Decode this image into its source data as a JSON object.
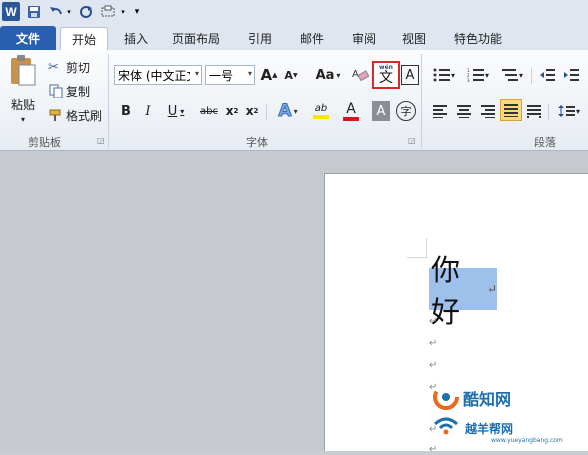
{
  "qat": {
    "app_logo": "W",
    "icons": [
      "save-icon",
      "undo-icon",
      "redo-icon",
      "print-preview-icon",
      "customize-qat-icon"
    ]
  },
  "tabs": [
    "文件",
    "开始",
    "插入",
    "页面布局",
    "引用",
    "邮件",
    "审阅",
    "视图",
    "特色功能"
  ],
  "clipboard": {
    "paste": "粘贴",
    "cut": "剪切",
    "copy": "复制",
    "format_painter": "格式刷",
    "group_label": "剪贴板"
  },
  "font": {
    "font_name": "宋体 (中文正文",
    "font_size": "一号",
    "grow_label": "A",
    "shrink_label": "A",
    "change_case": "Aa",
    "bold": "B",
    "italic": "I",
    "underline": "U",
    "strike": "abc",
    "subscript": "x",
    "superscript": "x",
    "text_effect": "A",
    "highlight": "ab",
    "font_color": "A",
    "char_shading": "A",
    "enclose": "字",
    "phonetic_top": "wén",
    "phonetic_char": "文",
    "char_border": "A",
    "group_label": "字体",
    "highlight_color": "#ffe600",
    "font_color_value": "#d01818"
  },
  "paragraph": {
    "group_label": "段落"
  },
  "document": {
    "selected_text": "你好",
    "accent_highlight": "#9dc1ea",
    "watermark_name": "酷知网",
    "watermark_site": "越羊帮网",
    "watermark_url": "www.yueyangbang.com"
  }
}
